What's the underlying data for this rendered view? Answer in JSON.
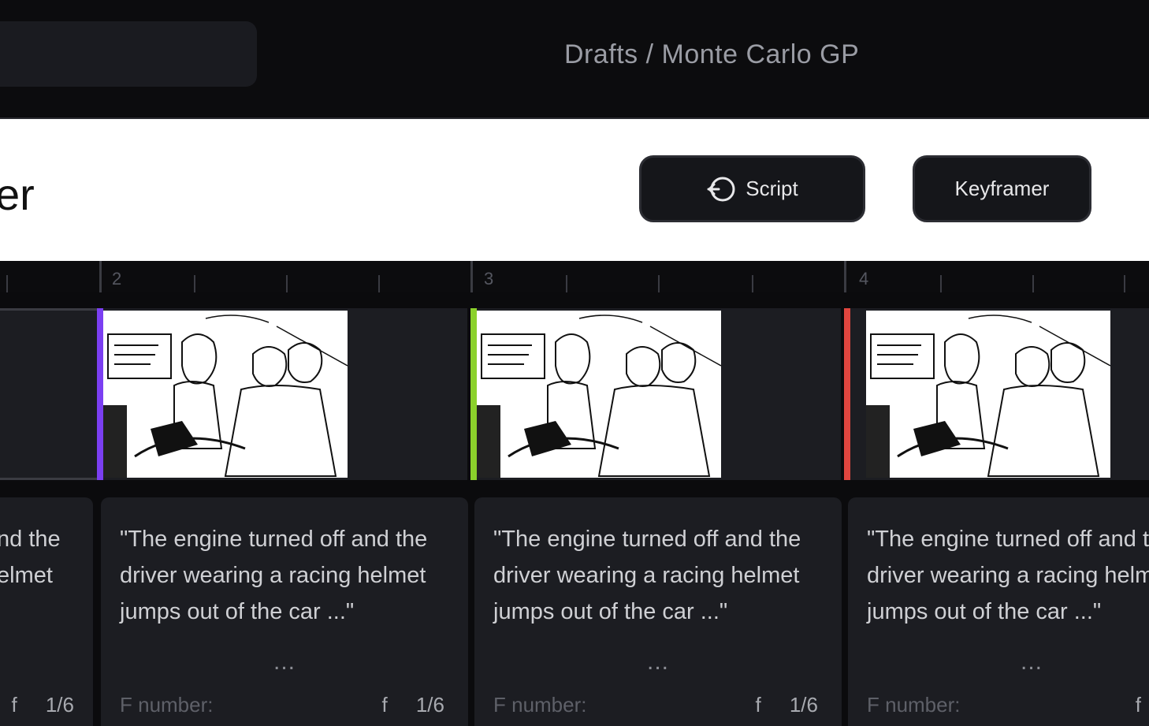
{
  "breadcrumb": "Drafts / Monte Carlo GP",
  "header": {
    "title_fragment": "er"
  },
  "buttons": {
    "script": "Script",
    "keyframer": "Keyframer"
  },
  "ruler": {
    "numbers": [
      "2",
      "3",
      "4"
    ]
  },
  "shots": [
    {
      "text_partial": [
        "nd the",
        "elmet"
      ],
      "frame_label_partial": "f",
      "frame_count": "1/6"
    },
    {
      "marker_color": "#7b3ff2",
      "text": "\"The engine turned off and the driver wearing a racing helmet jumps out of the car ...\"",
      "more": "...",
      "frame_label": "F number:",
      "frame_flag": "f",
      "frame_count": "1/6"
    },
    {
      "marker_color": "#8bd12b",
      "text": "\"The engine turned off and the driver wearing a racing helmet jumps out of the car ...\"",
      "more": "...",
      "frame_label": "F number:",
      "frame_flag": "f",
      "frame_count": "1/6"
    },
    {
      "marker_color": "#e0463f",
      "text": "\"The engine turned off and the driver wearing a racing helmet jumps out of the car ...\"",
      "more": "...",
      "frame_label": "F number:",
      "frame_flag": "f"
    }
  ]
}
